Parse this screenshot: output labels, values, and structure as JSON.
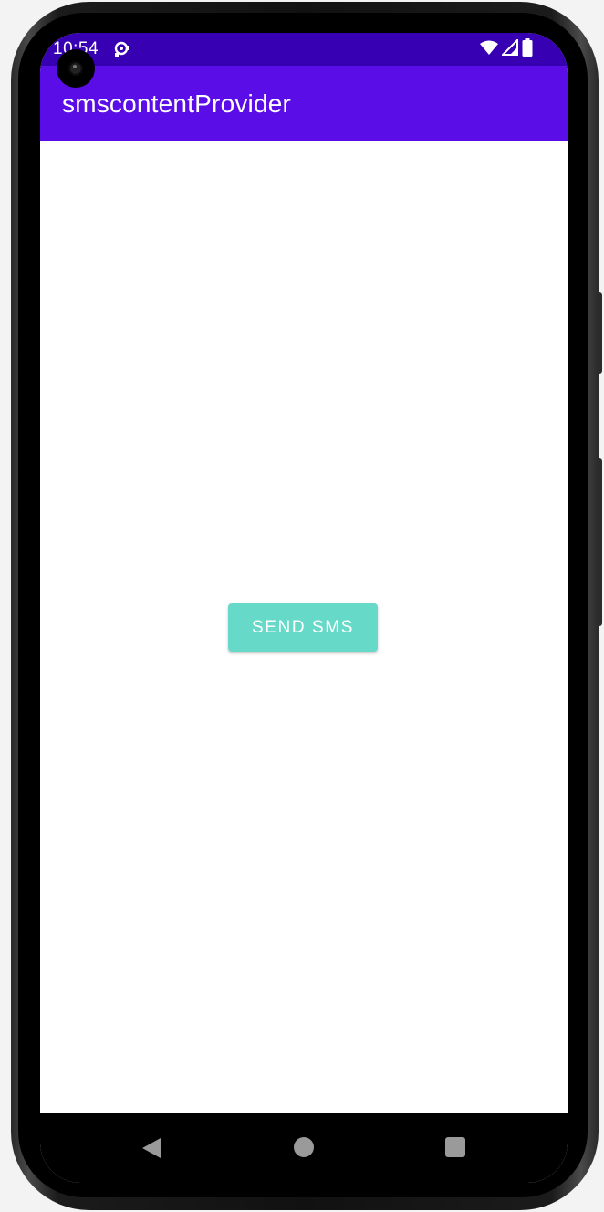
{
  "status_bar": {
    "time": "10:54",
    "notification_icon": "data-sync-icon",
    "wifi_icon": "wifi-icon",
    "signal_icon": "cell-signal-icon",
    "battery_icon": "battery-icon",
    "color": "#3700b3"
  },
  "app_bar": {
    "title": "smscontentProvider",
    "color": "#5a0de6"
  },
  "main": {
    "send_button_label": "SEND SMS",
    "button_color": "#66d9c8"
  },
  "nav_bar": {
    "back_icon": "back-triangle-icon",
    "home_icon": "home-circle-icon",
    "recents_icon": "recents-square-icon"
  }
}
